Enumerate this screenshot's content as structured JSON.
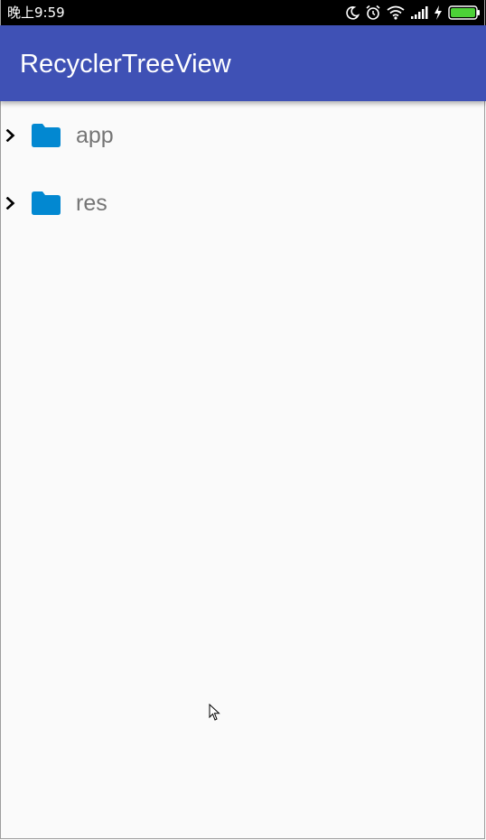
{
  "status_bar": {
    "time": "晚上9:59",
    "icons": [
      "moon-icon",
      "alarm-icon",
      "wifi-icon",
      "signal-icon",
      "charging-icon",
      "battery-icon"
    ],
    "battery_color": "#4cd137"
  },
  "app_bar": {
    "title": "RecyclerTreeView",
    "color": "#3f51b5"
  },
  "tree": {
    "items": [
      {
        "label": "app",
        "icon": "folder-icon",
        "expand_icon": "chevron-right-icon"
      },
      {
        "label": "res",
        "icon": "folder-icon",
        "expand_icon": "chevron-right-icon"
      }
    ],
    "folder_color": "#0288d1"
  }
}
